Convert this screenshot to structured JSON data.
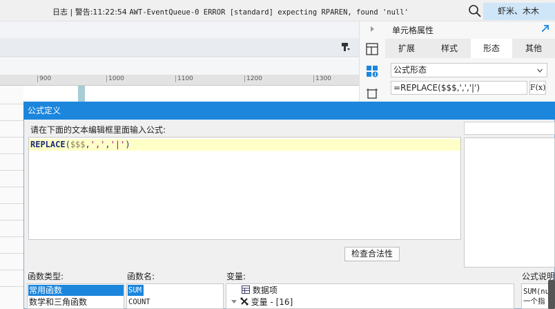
{
  "top_bar": {
    "log_prefix": "日志 | 警告:11:22:54 ",
    "log_message": "AWT-EventQueue-0 ERROR [standard] expecting RPAREN, found 'null'",
    "search_icon": "search-icon",
    "user_name": "虾米、木木",
    "user_bg": "#cfe6f8"
  },
  "ruler": {
    "ticks": [
      "900",
      "1000",
      "1100",
      "1200",
      "1300"
    ]
  },
  "cell_panel": {
    "title": "单元格属性",
    "tabs": [
      "扩展",
      "样式",
      "形态",
      "其他"
    ],
    "active_tab": "形态",
    "display_combo": "公式形态",
    "formula_value": "=REPLACE($$$,',','|')",
    "fx_label": "F(x)"
  },
  "dialog": {
    "title": "公式定义",
    "title_bg": "#1c86dd",
    "prompt": "请在下面的文本编辑框里面输入公式:",
    "formula_tokens": [
      {
        "t": "REPLACE",
        "c": "kw"
      },
      {
        "t": "(",
        "c": "pun"
      },
      {
        "t": "$$$",
        "c": "var"
      },
      {
        "t": ",",
        "c": "pun"
      },
      {
        "t": "','",
        "c": "str"
      },
      {
        "t": ",",
        "c": "pun"
      },
      {
        "t": "'|'",
        "c": "str"
      },
      {
        "t": ")",
        "c": "pun"
      }
    ],
    "check_button": "检查合法性",
    "function_type_label": "函数类型:",
    "function_types": [
      "常用函数",
      "数学和三角函数"
    ],
    "selected_function_type": "常用函数",
    "function_name_label": "函数名:",
    "function_names": [
      "SUM",
      "COUNT"
    ],
    "selected_function_name": "SUM",
    "variable_label": "变量:",
    "variables": [
      {
        "label": "数据项",
        "icon": "table-icon"
      },
      {
        "label": "变量 - [16]",
        "icon": "variable-icon"
      }
    ],
    "description_label": "公式说明",
    "description_lines": [
      "SUM(nu",
      "一个指"
    ]
  }
}
